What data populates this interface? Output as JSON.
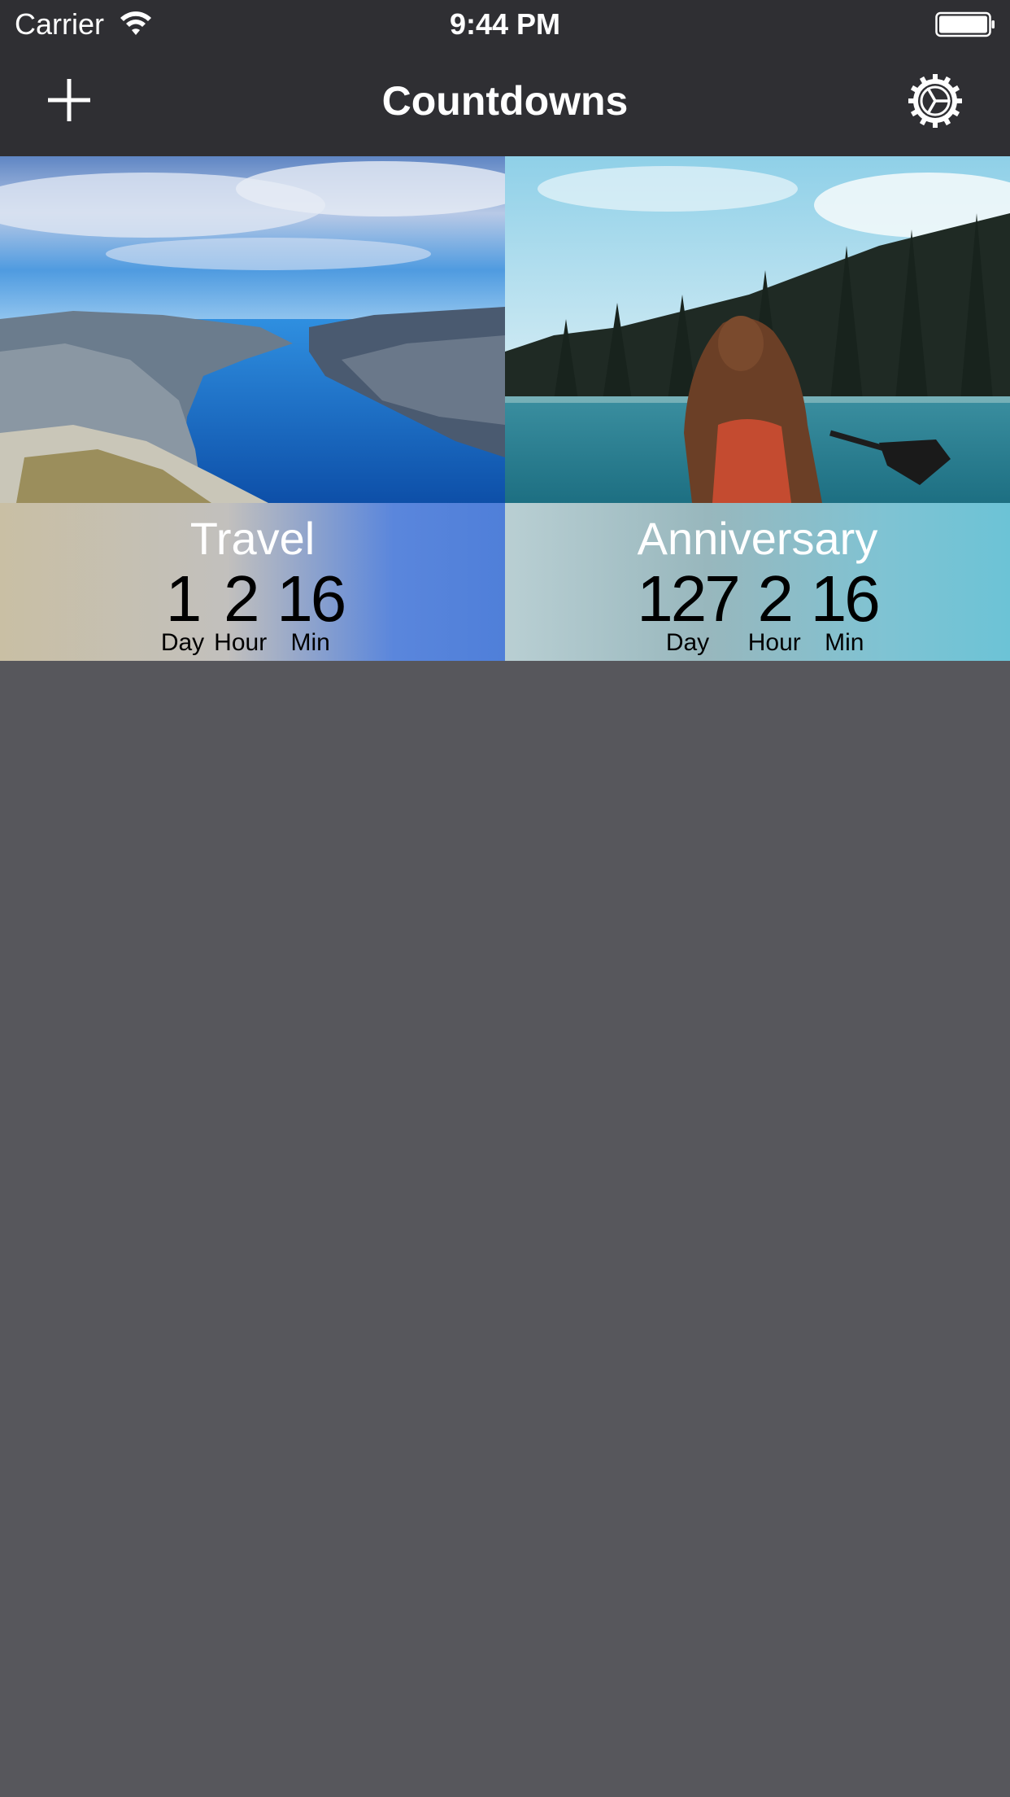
{
  "status_bar": {
    "carrier": "Carrier",
    "time": "9:44 PM",
    "wifi_icon": "wifi-icon",
    "battery_icon": "battery-icon"
  },
  "nav": {
    "title": "Countdowns",
    "add_icon": "plus-icon",
    "settings_icon": "gear-icon"
  },
  "colors": {
    "bar_background": "#2f2f33",
    "page_background": "#57575c",
    "card_text": "#ffffff",
    "countdown_text": "#000000"
  },
  "countdowns": [
    {
      "title": "Travel",
      "image": "fjord-landscape-photo",
      "day": "1",
      "day_label": "Day",
      "hour": "2",
      "hour_label": "Hour",
      "min": "16",
      "min_label": "Min"
    },
    {
      "title": "Anniversary",
      "image": "woman-canoe-lake-photo",
      "day": "127",
      "day_label": "Day",
      "hour": "2",
      "hour_label": "Hour",
      "min": "16",
      "min_label": "Min"
    }
  ]
}
